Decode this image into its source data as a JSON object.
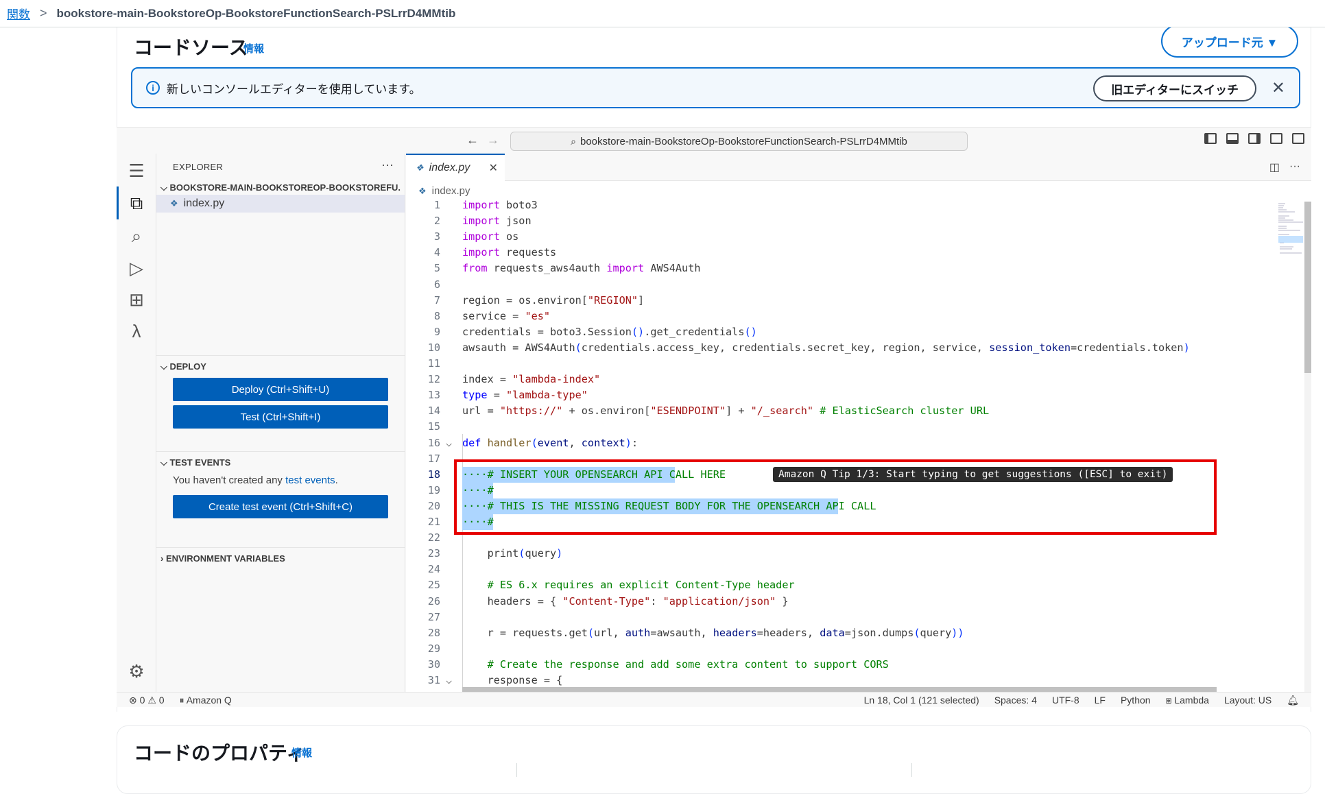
{
  "breadcrumb": {
    "root": "関数",
    "current": "bookstore-main-BookstoreOp-BookstoreFunctionSearch-PSLrrD4MMtib"
  },
  "section": {
    "title": "コードソース",
    "info": "情報",
    "upload_label": "アップロード元 ▼"
  },
  "banner": {
    "message": "新しいコンソールエディターを使用しています。",
    "switch_label": "旧エディターにスイッチ"
  },
  "ide": {
    "command_center": "bookstore-main-BookstoreOp-BookstoreFunctionSearch-PSLrrD4MMtib",
    "explorer": {
      "header": "EXPLORER",
      "folder": "BOOKSTORE-MAIN-BOOKSTOREOP-BOOKSTOREFU...",
      "file": "index.py"
    },
    "deploy": {
      "header": "DEPLOY",
      "deploy_label": "Deploy (Ctrl+Shift+U)",
      "test_label": "Test (Ctrl+Shift+I)"
    },
    "test_events": {
      "header": "TEST EVENTS",
      "text_prefix": "You haven't created any ",
      "link": "test events",
      "text_suffix": ".",
      "create_label": "Create test event (Ctrl+Shift+C)"
    },
    "env_vars_header": "ENVIRONMENT VARIABLES",
    "tab": "index.py",
    "breadcrumb_file": "index.py",
    "q_tip": "Amazon Q Tip 1/3: Start typing to get suggestions ([ESC] to exit)",
    "status": {
      "errors": "0",
      "warnings": "0",
      "amazon_q": "Amazon Q",
      "position": "Ln 18, Col 1 (121 selected)",
      "spaces": "Spaces: 4",
      "encoding": "UTF-8",
      "eol": "LF",
      "language": "Python",
      "lambda": "Lambda",
      "layout": "Layout: US"
    },
    "current_line": 18,
    "code_lines": [
      [
        [
          "kw",
          "import"
        ],
        [
          "t",
          " boto3"
        ]
      ],
      [
        [
          "kw",
          "import"
        ],
        [
          "t",
          " json"
        ]
      ],
      [
        [
          "kw",
          "import"
        ],
        [
          "t",
          " os"
        ]
      ],
      [
        [
          "kw",
          "import"
        ],
        [
          "t",
          " requests"
        ]
      ],
      [
        [
          "kw",
          "from"
        ],
        [
          "t",
          " requests_aws4auth "
        ],
        [
          "kw",
          "import"
        ],
        [
          "t",
          " AWS4Auth"
        ]
      ],
      [],
      [
        [
          "t",
          "region = os.environ["
        ],
        [
          "str",
          "\"REGION\""
        ],
        [
          "t",
          "]"
        ]
      ],
      [
        [
          "t",
          "service = "
        ],
        [
          "str",
          "\"es\""
        ]
      ],
      [
        [
          "t",
          "credentials = boto3.Session"
        ],
        [
          "par",
          "()"
        ],
        [
          "t",
          ".get_credentials"
        ],
        [
          "par",
          "()"
        ]
      ],
      [
        [
          "t",
          "awsauth = AWS4Auth"
        ],
        [
          "par",
          "("
        ],
        [
          "t",
          "credentials.access_key, credentials.secret_key, region, service, "
        ],
        [
          "var",
          "session_token"
        ],
        [
          "t",
          "=credentials.token"
        ],
        [
          "par",
          ")"
        ]
      ],
      [],
      [
        [
          "t",
          "index = "
        ],
        [
          "str",
          "\"lambda-index\""
        ]
      ],
      [
        [
          "kw2",
          "type"
        ],
        [
          "t",
          " = "
        ],
        [
          "str",
          "\"lambda-type\""
        ]
      ],
      [
        [
          "t",
          "url = "
        ],
        [
          "str",
          "\"https://\""
        ],
        [
          "t",
          " + os.environ["
        ],
        [
          "str",
          "\"ESENDPOINT\""
        ],
        [
          "t",
          "] + "
        ],
        [
          "str",
          "\"/_search\""
        ],
        [
          "t",
          " "
        ],
        [
          "cm",
          "# ElasticSearch cluster URL"
        ]
      ],
      [],
      [
        [
          "kw2",
          "def"
        ],
        [
          "t",
          " "
        ],
        [
          "fn",
          "handler"
        ],
        [
          "par",
          "("
        ],
        [
          "var",
          "event"
        ],
        [
          "t",
          ", "
        ],
        [
          "var",
          "context"
        ],
        [
          "par",
          ")"
        ],
        [
          "t",
          ":"
        ]
      ],
      [],
      [
        [
          "cm",
          "····# INSERT YOUR OPENSEARCH API CALL HERE"
        ]
      ],
      [
        [
          "cm",
          "····#"
        ]
      ],
      [
        [
          "cm",
          "····# THIS IS THE MISSING REQUEST BODY FOR THE OPENSEARCH API CALL"
        ]
      ],
      [
        [
          "cm",
          "····#"
        ]
      ],
      [],
      [
        [
          "t",
          "    print"
        ],
        [
          "par",
          "("
        ],
        [
          "t",
          "query"
        ],
        [
          "par",
          ")"
        ]
      ],
      [],
      [
        [
          "cm",
          "    # ES 6.x requires an explicit Content-Type header"
        ]
      ],
      [
        [
          "t",
          "    headers = { "
        ],
        [
          "str",
          "\"Content-Type\""
        ],
        [
          "t",
          ": "
        ],
        [
          "str",
          "\"application/json\""
        ],
        [
          "t",
          " }"
        ]
      ],
      [],
      [
        [
          "t",
          "    r = requests.get"
        ],
        [
          "par",
          "("
        ],
        [
          "t",
          "url, "
        ],
        [
          "var",
          "auth"
        ],
        [
          "t",
          "=awsauth, "
        ],
        [
          "var",
          "headers"
        ],
        [
          "t",
          "=headers, "
        ],
        [
          "var",
          "data"
        ],
        [
          "t",
          "=json.dumps"
        ],
        [
          "par",
          "("
        ],
        [
          "t",
          "query"
        ],
        [
          "par",
          "))"
        ]
      ],
      [],
      [
        [
          "cm",
          "    # Create the response and add some extra content to support CORS"
        ]
      ],
      [
        [
          "t",
          "    response = {"
        ]
      ]
    ]
  },
  "properties": {
    "title": "コードのプロパティ",
    "info": "情報"
  }
}
